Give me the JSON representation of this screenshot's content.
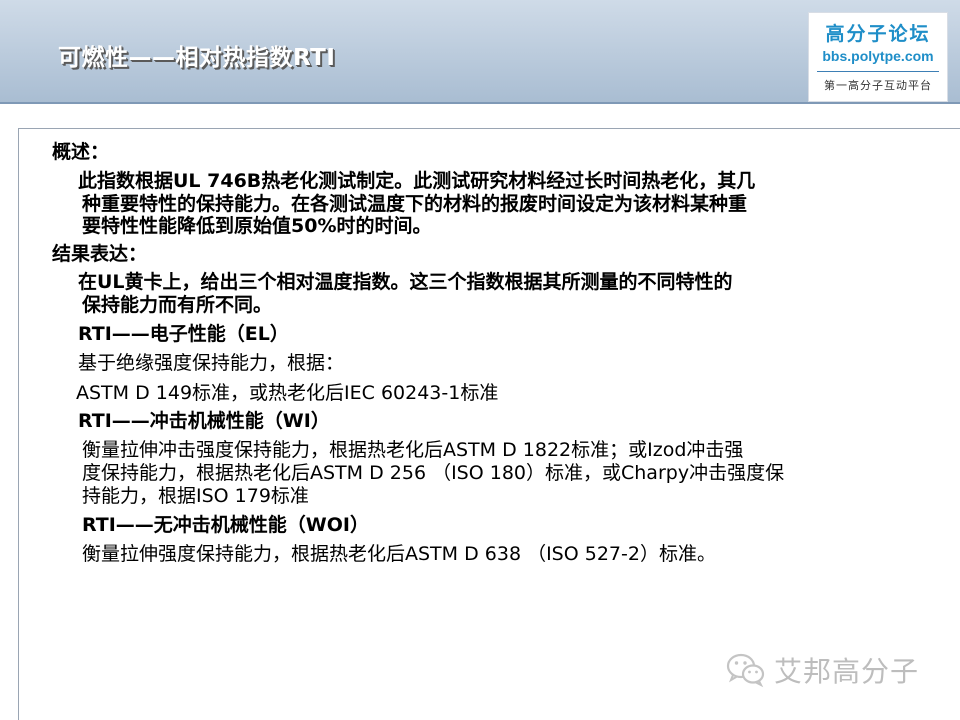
{
  "slide": {
    "title": "可燃性——相对热指数RTI",
    "logo": {
      "name": "高分子论坛",
      "url": "bbs.polytpe.com",
      "slogan": "第一高分子互动平台"
    },
    "lines": [
      "概述：",
      "此指数根据UL 746B热老化测试制定。此测试研究材料经过长时间热老化，其几",
      "种重要特性的保持能力。在各测试温度下的材料的报废时间设定为该材料某种重",
      "要特性性能降低到原始值50%时的时间。",
      "结果表达：",
      "在UL黄卡上，给出三个相对温度指数。这三个指数根据其所测量的不同特性的",
      "保持能力而有所不同。",
      "RTI——电子性能（EL）",
      "基于绝缘强度保持能力，根据：",
      "ASTM D 149标准，或热老化后IEC 60243-1标准",
      "RTI——冲击机械性能（WI）",
      "衡量拉伸冲击强度保持能力，根据热老化后ASTM D 1822标准；或Izod冲击强",
      "度保持能力，根据热老化后ASTM D 256 （ISO 180）标准，或Charpy冲击强度保",
      "持能力，根据ISO 179标准",
      "RTI——无冲击机械性能（WOI）",
      "衡量拉伸强度保持能力，根据热老化后ASTM D 638 （ISO 527-2）标准。"
    ],
    "watermark": "艾邦高分子",
    "watermark_icon": "wechat-icon"
  }
}
